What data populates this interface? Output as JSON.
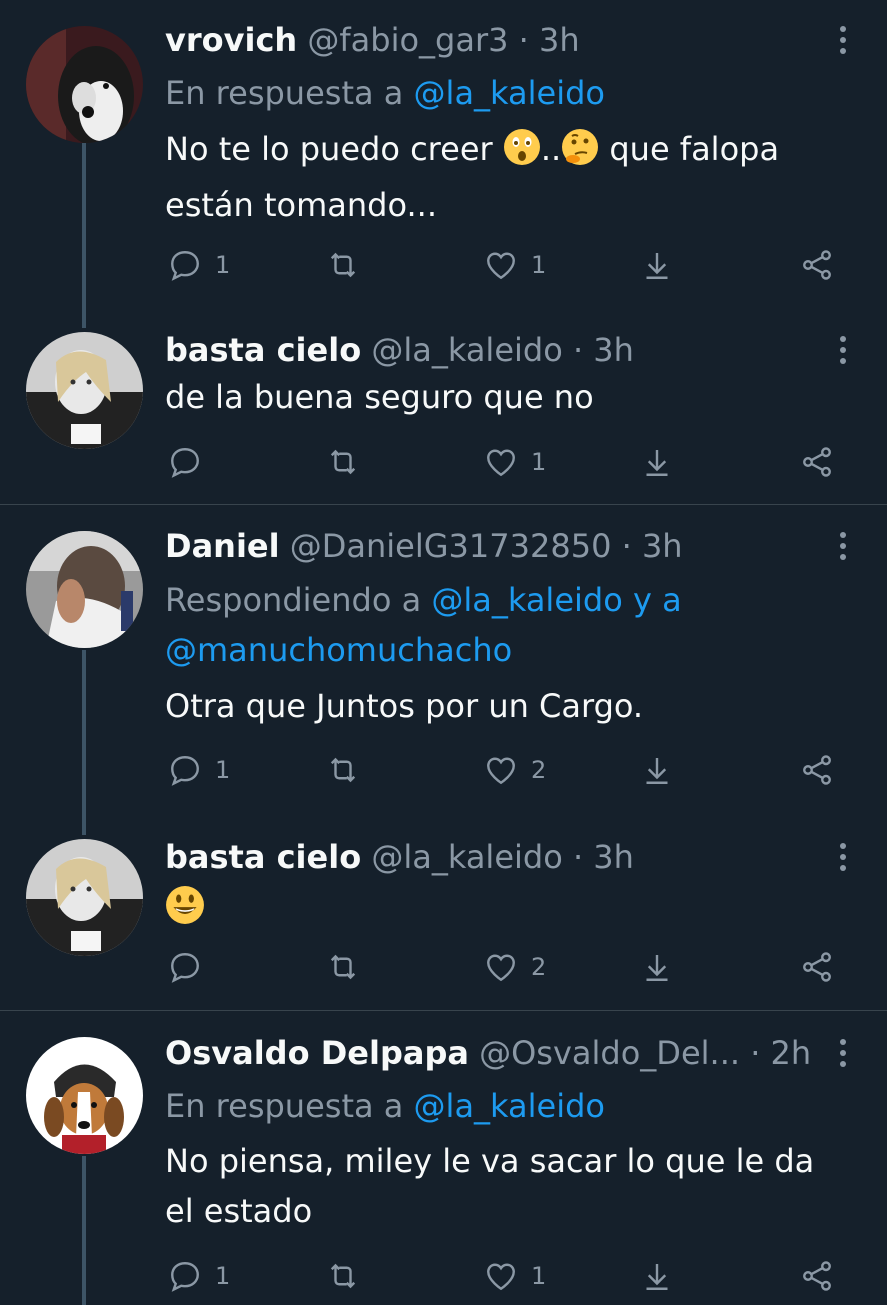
{
  "tweets": [
    {
      "name": "vrovich",
      "handle": "@fabio_gar3",
      "sep": "·",
      "time": "3h",
      "reply_prefix": "En respuesta a",
      "reply_mention": "@la_kaleido",
      "text_line1_a": "No te lo puedo creer",
      "text_line1_dots": "..",
      "text_line1_b": "que falopa",
      "text_line2": "están tomando...",
      "emoji1": "astonished-face",
      "emoji2": "thinking-face",
      "reply_count": "1",
      "like_count": "1"
    },
    {
      "name": "basta cielo",
      "handle": "@la_kaleido",
      "sep": "·",
      "time": "3h",
      "text": "de la buena seguro que no",
      "reply_count": "",
      "like_count": "1"
    },
    {
      "name": "Daniel",
      "handle": "@DanielG31732850",
      "sep": "·",
      "time": "3h",
      "reply_prefix": "Respondiendo a",
      "reply_mention": "@la_kaleido y a",
      "reply_mention2": "@manuchomuchacho",
      "text": "Otra que Juntos por un Cargo.",
      "reply_count": "1",
      "like_count": "2"
    },
    {
      "name": "basta cielo",
      "handle": "@la_kaleido",
      "sep": "·",
      "time": "3h",
      "emoji": "grinning-face",
      "reply_count": "",
      "like_count": "2"
    },
    {
      "name": "Osvaldo Delpapa",
      "handle": "@Osvaldo_Del...",
      "sep": "·",
      "time": "2h",
      "reply_prefix": "En respuesta a",
      "reply_mention": "@la_kaleido",
      "text_line1": "No piensa, miley le va sacar lo que le da",
      "text_line2": "el estado",
      "reply_count": "1",
      "like_count": "1"
    }
  ],
  "colors": {
    "background": "#15202b",
    "text": "#f7f9f9",
    "secondary": "#8b98a5",
    "mention": "#1d9bf0",
    "thread_line": "#3d5466",
    "divider": "#38444d"
  },
  "icons": [
    "reply-icon",
    "retweet-icon",
    "like-icon",
    "download-icon",
    "share-icon",
    "more-icon"
  ]
}
